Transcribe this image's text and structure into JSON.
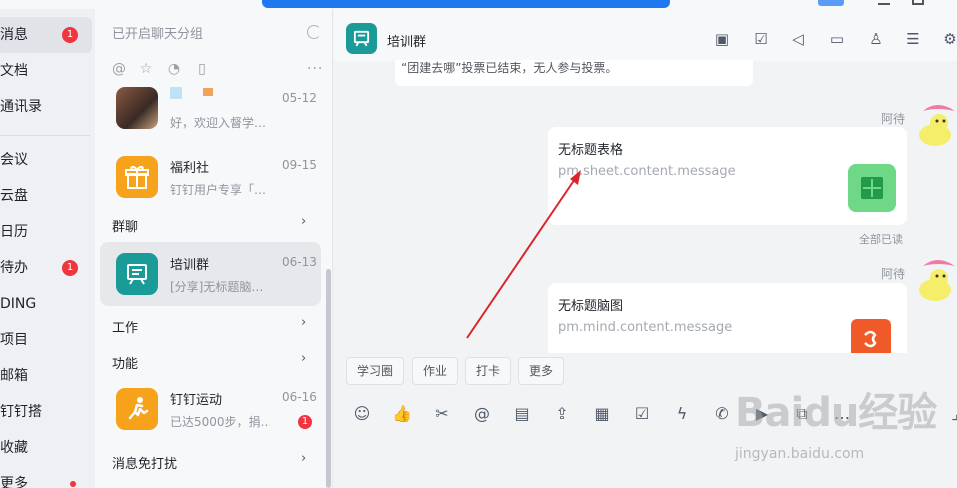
{
  "nav": {
    "items": [
      {
        "label": "消息",
        "badge": "1",
        "active": true
      },
      {
        "label": "文档"
      },
      {
        "label": "通讯录"
      },
      {
        "label": "会议"
      },
      {
        "label": "云盘"
      },
      {
        "label": "日历"
      },
      {
        "label": "待办",
        "badge": "1"
      },
      {
        "label": "DING"
      },
      {
        "label": "项目"
      },
      {
        "label": "邮箱"
      },
      {
        "label": "钉钉搭"
      },
      {
        "label": "收藏"
      },
      {
        "label": "更多",
        "dot": true
      }
    ]
  },
  "list": {
    "header": "已开启聊天分组",
    "filters": [
      "at-icon",
      "star-icon",
      "clock-icon",
      "bookmark-icon"
    ],
    "conversations": [
      {
        "title": "…",
        "time": "05-12",
        "preview": "好，欢迎入督学…"
      },
      {
        "title": "福利社",
        "time": "09-15",
        "preview": "钉钉用户专享「…"
      },
      {
        "title": "培训群",
        "time": "06-13",
        "preview": "[分享]无标题脑…",
        "selected": true
      },
      {
        "title": "钉钉运动",
        "time": "06-16",
        "preview": "已达5000步，捐…",
        "badge": "1"
      }
    ],
    "groups": {
      "group_chat": "群聊",
      "work": "工作",
      "function": "功能",
      "dnd": "消息免打扰"
    }
  },
  "chat": {
    "title": "培训群",
    "system_message": "“团建去哪”投票已结束，无人参与投票。",
    "sender": "阿待",
    "cards": [
      {
        "title": "无标题表格",
        "message": "pm.sheet.content.message",
        "icon": "sheet-icon",
        "color": "#2cb45c"
      },
      {
        "title": "无标题脑图",
        "message": "pm.mind.content.message",
        "icon": "mindmap-icon",
        "color": "#f05a28"
      }
    ],
    "read_receipt": "全部已读",
    "quick_replies": [
      "学习圈",
      "作业",
      "打卡",
      "更多"
    ]
  },
  "watermark": {
    "big": "Baidu经验",
    "small": "jingyan.baidu.com"
  }
}
